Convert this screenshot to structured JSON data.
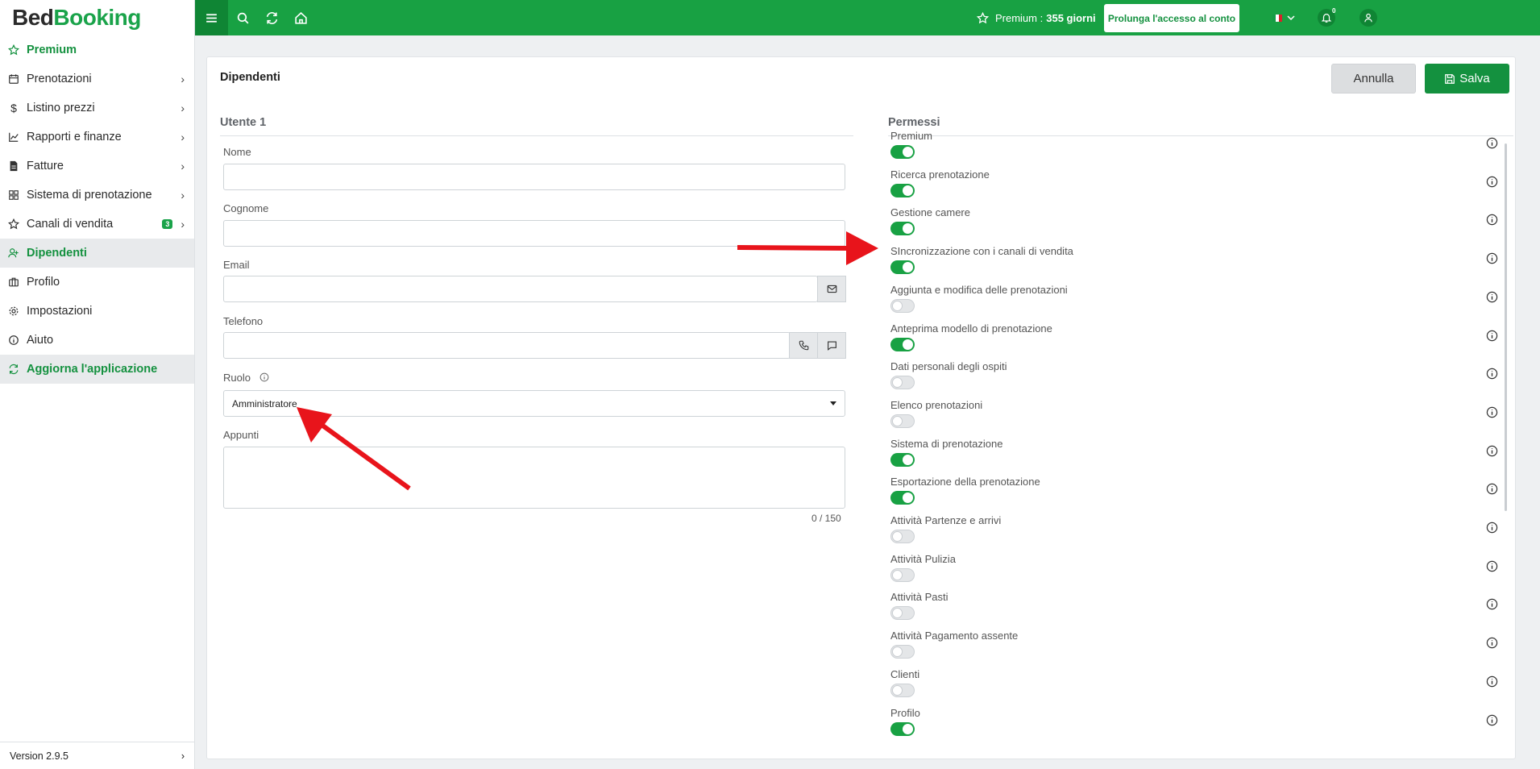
{
  "app": {
    "logo_part1": "Bed",
    "logo_part2": "Booking",
    "version": "Version 2.9.5"
  },
  "sidebar": {
    "items": [
      {
        "label": "Premium",
        "icon": "star-icon"
      },
      {
        "label": "Prenotazioni",
        "icon": "calendar-icon"
      },
      {
        "label": "Listino prezzi",
        "icon": "dollar-icon"
      },
      {
        "label": "Rapporti e finanze",
        "icon": "chart-icon"
      },
      {
        "label": "Fatture",
        "icon": "invoice-icon"
      },
      {
        "label": "Sistema di prenotazione",
        "icon": "grid-icon"
      },
      {
        "label": "Canali di vendita",
        "icon": "star-icon",
        "badge": "3"
      },
      {
        "label": "Dipendenti",
        "icon": "user-plus-icon"
      },
      {
        "label": "Profilo",
        "icon": "briefcase-icon"
      },
      {
        "label": "Impostazioni",
        "icon": "gear-icon"
      },
      {
        "label": "Aiuto",
        "icon": "info-icon"
      },
      {
        "label": "Aggiorna l'applicazione",
        "icon": "refresh-icon"
      }
    ]
  },
  "topbar": {
    "premium_label": "Premium :",
    "premium_days": "355 giorni",
    "extend_button": "Prolunga l'accesso al conto",
    "notifications_count": "0"
  },
  "page": {
    "title": "Dipendenti",
    "cancel_label": "Annulla",
    "save_label": "Salva"
  },
  "form": {
    "section_title": "Utente 1",
    "name_label": "Nome",
    "name_value": "",
    "surname_label": "Cognome",
    "surname_value": "",
    "email_label": "Email",
    "email_value": "",
    "phone_label": "Telefono",
    "phone_value": "",
    "role_label": "Ruolo",
    "role_value": "Amministratore",
    "notes_label": "Appunti",
    "notes_value": "",
    "notes_counter": "0 / 150"
  },
  "permissions": {
    "section_title": "Permessi",
    "items": [
      {
        "label": "Premium",
        "enabled": true
      },
      {
        "label": "Ricerca prenotazione",
        "enabled": true
      },
      {
        "label": "Gestione camere",
        "enabled": true
      },
      {
        "label": "SIncronizzazione con i canali di vendita",
        "enabled": true
      },
      {
        "label": "Aggiunta e modifica delle prenotazioni",
        "enabled": false
      },
      {
        "label": "Anteprima modello di prenotazione",
        "enabled": true
      },
      {
        "label": "Dati personali degli ospiti",
        "enabled": false
      },
      {
        "label": "Elenco prenotazioni",
        "enabled": false
      },
      {
        "label": "Sistema di prenotazione",
        "enabled": true
      },
      {
        "label": "Esportazione della prenotazione",
        "enabled": true
      },
      {
        "label": "Attività Partenze e arrivi",
        "enabled": false
      },
      {
        "label": "Attività Pulizia",
        "enabled": false
      },
      {
        "label": "Attività Pasti",
        "enabled": false
      },
      {
        "label": "Attività Pagamento assente",
        "enabled": false
      },
      {
        "label": "Clienti",
        "enabled": false
      },
      {
        "label": "Profilo",
        "enabled": true
      }
    ]
  },
  "colors": {
    "brand": "#18a143",
    "brand_dark": "#0f8534",
    "annotation": "#e8141b"
  }
}
